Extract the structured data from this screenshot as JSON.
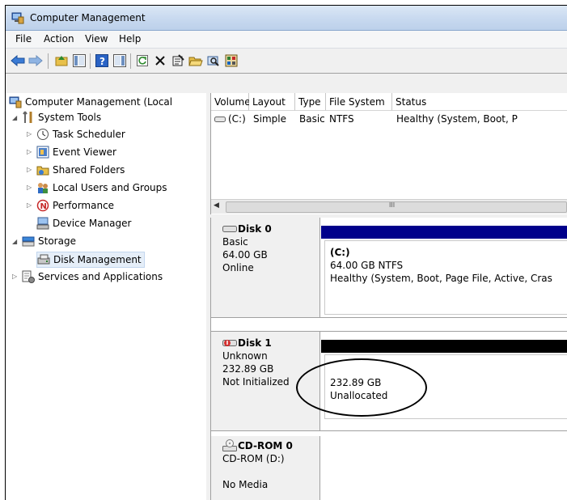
{
  "window": {
    "title": "Computer Management"
  },
  "menu": [
    "File",
    "Action",
    "View",
    "Help"
  ],
  "tree": {
    "root": "Computer Management (Local",
    "system_tools": "System Tools",
    "task_scheduler": "Task Scheduler",
    "event_viewer": "Event Viewer",
    "shared_folders": "Shared Folders",
    "local_users": "Local Users and Groups",
    "performance": "Performance",
    "device_manager": "Device Manager",
    "storage": "Storage",
    "disk_management": "Disk Management",
    "services": "Services and Applications"
  },
  "list": {
    "columns": [
      "Volume",
      "Layout",
      "Type",
      "File System",
      "Status"
    ],
    "rows": [
      {
        "volume": "(C:)",
        "layout": "Simple",
        "type": "Basic",
        "fs": "NTFS",
        "status": "Healthy (System, Boot, P"
      }
    ],
    "scroll_grip": "III"
  },
  "disks": [
    {
      "name": "Disk 0",
      "type": "Basic",
      "size": "64.00 GB",
      "state": "Online",
      "part_title": "(C:)",
      "part_size": "64.00 GB NTFS",
      "part_status": "Healthy (System, Boot, Page File, Active, Cras",
      "bar_color": "#00008b"
    },
    {
      "name": "Disk 1",
      "type": "Unknown",
      "size": "232.89 GB",
      "state": "Not Initialized",
      "part_size": "232.89 GB",
      "part_status": "Unallocated",
      "bar_color": "#000000"
    },
    {
      "name": "CD-ROM 0",
      "type": "CD-ROM (D:)",
      "state": "No Media"
    }
  ]
}
